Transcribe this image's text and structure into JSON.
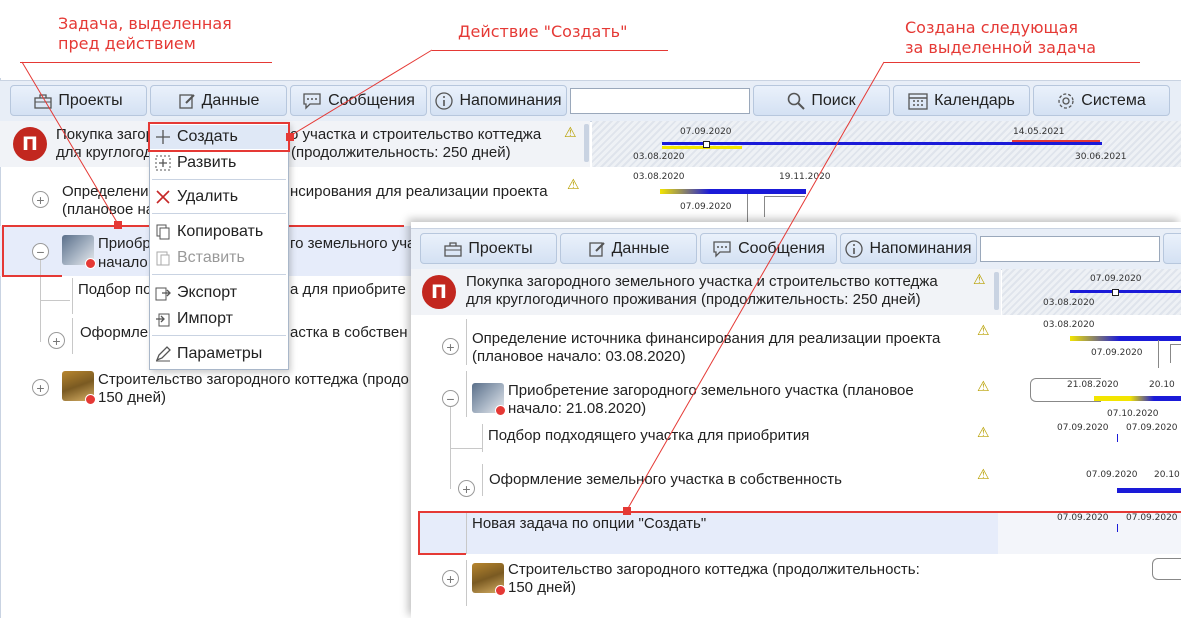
{
  "callouts": {
    "selected_task": "Задача, выделенная\nпред действием",
    "action_create": "Действие \"Создать\"",
    "created_next": "Создана следующая\nза выделенной задача"
  },
  "toolbar": {
    "projects": "Проекты",
    "data": "Данные",
    "messages": "Сообщения",
    "reminders": "Напоминания",
    "search_value": "",
    "search": "Поиск",
    "calendar": "Календарь",
    "system": "Система"
  },
  "project_badge": "П",
  "back": {
    "project_title": "Покупка загоро",
    "project_title_b": "о участка и строительство коттеджа",
    "project_title_2": "для круглогодичного проживания (продолжительность: 250 дней)",
    "task1_a": "Определени",
    "task1_b": "нсирования для реализации проекта",
    "task1_line2": "(плановое на",
    "task2_a": "Приобре",
    "task2_b": "го земельного уча",
    "task2_line2": "начало",
    "task3_a": "Подбор по",
    "task3_b": "а для приобрите",
    "task4_a": "Оформле",
    "task4_b": "астка в собствен",
    "task5": "Строительство загородного коттеджа (продо",
    "task5_line2": "150 дней)",
    "gantt_dates": {
      "d1": "07.09.2020",
      "d2": "14.05.2021",
      "d3": "03.08.2020",
      "d4": "30.06.2021",
      "d5": "03.08.2020",
      "d6": "19.11.2020",
      "d7": "07.09.2020"
    }
  },
  "context_menu": {
    "create": "Создать",
    "expand": "Развить",
    "delete": "Удалить",
    "copy": "Копировать",
    "paste": "Вставить",
    "export": "Экспорт",
    "import": "Импорт",
    "parameters": "Параметры"
  },
  "front": {
    "project_title": "Покупка загородного земельного участка и строительство коттеджа",
    "project_title_2": "для круглогодичного проживания (продолжительность: 250 дней)",
    "task1": "Определение источника финансирования для реализации проекта",
    "task1_line2": "(плановое начало: 03.08.2020)",
    "task2": "Приобретение загородного земельного участка (плановое",
    "task2_line2": "начало: 21.08.2020)",
    "task3": "Подбор подходящего участка для приобрития",
    "task4": "Оформление земельного участка в собственность",
    "new_task": "Новая задача по опции \"Создать\"",
    "task5": "Строительство загородного коттеджа (продолжительность:",
    "task5_line2": "150 дней)",
    "gantt_dates": {
      "p1": "07.09.2020",
      "p2": "03.08.2020",
      "t1a": "03.08.2020",
      "t1b": "07.09.2020",
      "t2a": "21.08.2020",
      "t2b": "20.10",
      "t2c": "07.10.2020",
      "t3a": "07.09.2020",
      "t3b": "07.09.2020",
      "t4a": "07.09.2020",
      "t4b": "20.10",
      "n1": "07.09.2020",
      "n2": "07.09.2020"
    }
  },
  "colors": {
    "accent_red": "#e53935",
    "badge_red": "#c2271f",
    "bar_blue": "#1a1ad8",
    "bar_yellow": "#f3e500",
    "selection": "#e6ecfa"
  }
}
